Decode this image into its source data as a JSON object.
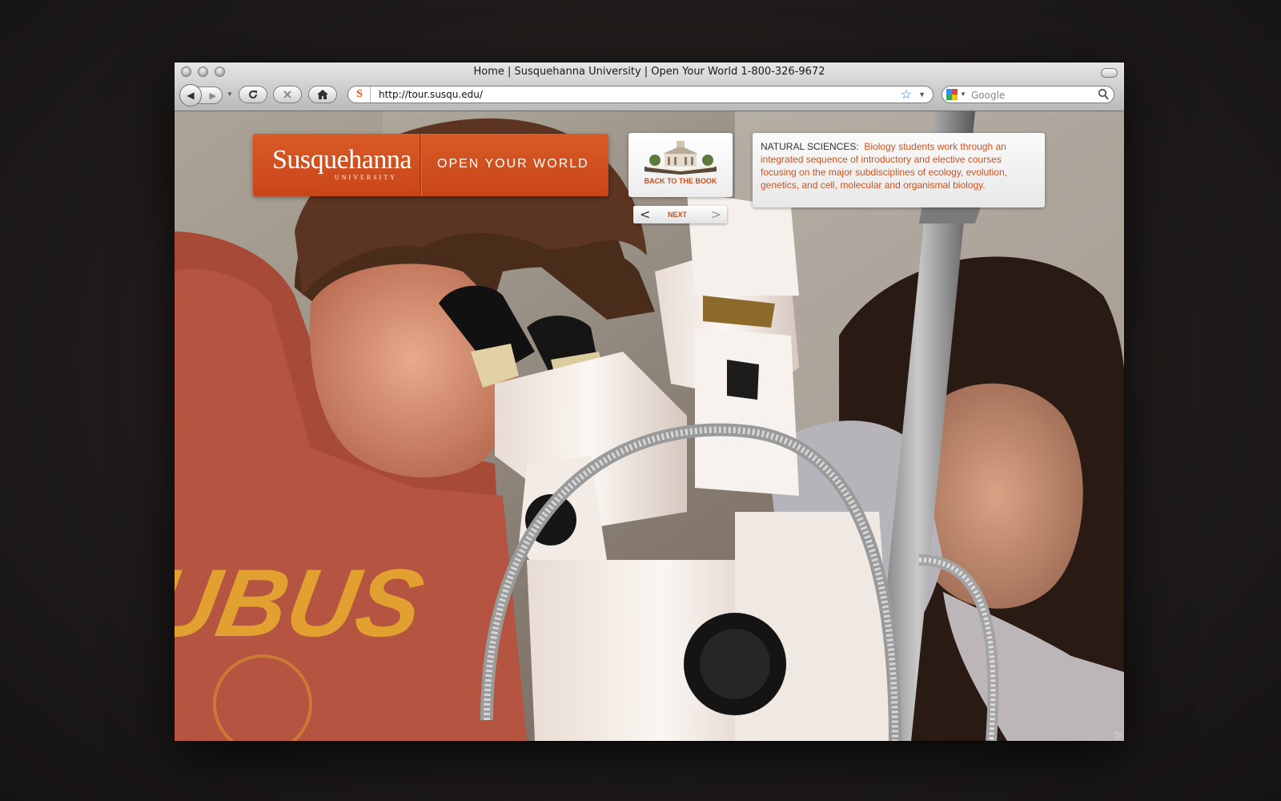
{
  "window": {
    "title": "Home | Susquehanna University | Open Your World 1-800-326-9672"
  },
  "toolbar": {
    "url": "http://tour.susqu.edu/",
    "search_placeholder": "Google",
    "favicon_letter": "S"
  },
  "brand": {
    "wordmark": "Susquehanna",
    "sub": "UNIVERSITY",
    "tagline": "OPEN YOUR WORLD",
    "color": "#d4521d"
  },
  "book": {
    "label": "BACK TO THE BOOK"
  },
  "pager": {
    "prev": "<",
    "next_label": "NEXT",
    "next": ">"
  },
  "info": {
    "heading": "NATURAL SCIENCES:",
    "body": "Biology students work through an integrated sequence of introductory and elective courses focusing on the major subdisciplines of ecology, evolution, genetics, and cell, molecular and organismal biology."
  },
  "photo": {
    "shirt_text": "CUBUS"
  }
}
